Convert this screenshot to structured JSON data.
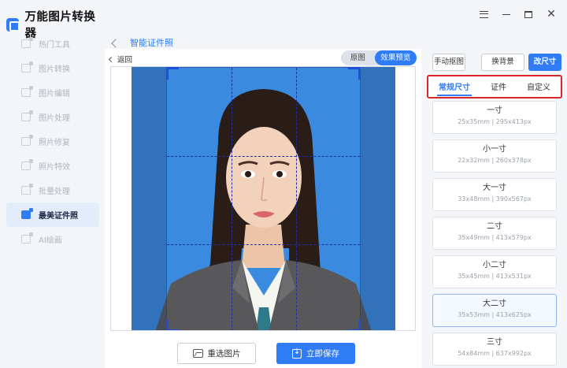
{
  "app": {
    "title": "万能图片转换器"
  },
  "sidebar": {
    "items": [
      {
        "label": "热门工具"
      },
      {
        "label": "图片转换"
      },
      {
        "label": "图片编辑"
      },
      {
        "label": "图片处理"
      },
      {
        "label": "照片修复"
      },
      {
        "label": "照片特效"
      },
      {
        "label": "批量处理"
      },
      {
        "label": "最美证件照",
        "active": true
      },
      {
        "label": "AI绘画"
      }
    ]
  },
  "header": {
    "page_title": "智能证件照"
  },
  "editor": {
    "back_label": "返回",
    "view_toggle": {
      "original": "原图",
      "preview": "效果预览",
      "selected": "效果预览"
    },
    "photo": {
      "background_color": "#3a8be0"
    },
    "reselect_label": "重选图片",
    "save_label": "立即保存"
  },
  "right_panel": {
    "manual_cutout": "手动抠图",
    "change_background": "换背景",
    "change_size": "改尺寸",
    "tabs": [
      {
        "label": "常规尺寸",
        "active": true
      },
      {
        "label": "证件"
      },
      {
        "label": "自定义"
      }
    ],
    "sizes": [
      {
        "name": "一寸",
        "dims": "25x35mm | 295x413px"
      },
      {
        "name": "小一寸",
        "dims": "22x32mm | 260x378px"
      },
      {
        "name": "大一寸",
        "dims": "33x48mm | 390x567px"
      },
      {
        "name": "二寸",
        "dims": "35x49mm | 413x579px"
      },
      {
        "name": "小二寸",
        "dims": "35x45mm | 413x531px"
      },
      {
        "name": "大二寸",
        "dims": "35x53mm | 413x625px",
        "selected": true
      },
      {
        "name": "三寸",
        "dims": "54x84mm | 637x992px"
      }
    ]
  },
  "colors": {
    "accent": "#2f7cf6",
    "highlight_border": "#d9262b"
  }
}
